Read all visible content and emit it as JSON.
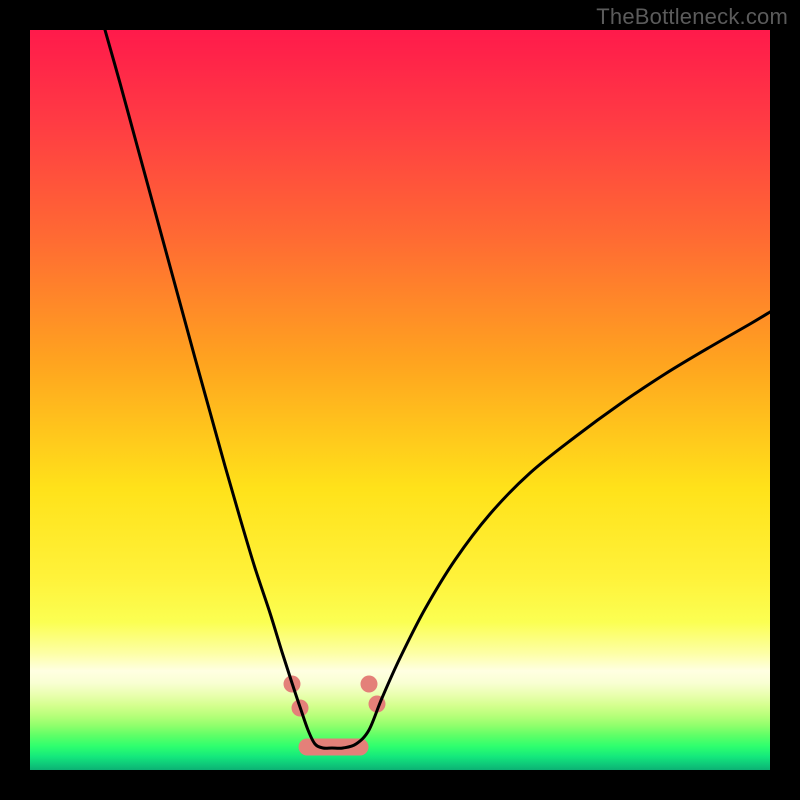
{
  "watermark": "TheBottleneck.com",
  "colors": {
    "frame": "#000000",
    "salmon": "#e48079",
    "curve": "#000000",
    "gradient_stops": [
      {
        "offset": 0.0,
        "color": "#ff1a4b"
      },
      {
        "offset": 0.12,
        "color": "#ff3a44"
      },
      {
        "offset": 0.28,
        "color": "#ff6a33"
      },
      {
        "offset": 0.45,
        "color": "#ffa41f"
      },
      {
        "offset": 0.62,
        "color": "#ffe21a"
      },
      {
        "offset": 0.74,
        "color": "#fff23a"
      },
      {
        "offset": 0.8,
        "color": "#fbff52"
      },
      {
        "offset": 0.842,
        "color": "#fdffa5"
      },
      {
        "offset": 0.866,
        "color": "#ffffe2"
      },
      {
        "offset": 0.882,
        "color": "#f9ffd3"
      },
      {
        "offset": 0.898,
        "color": "#eaffb0"
      },
      {
        "offset": 0.912,
        "color": "#d6ff90"
      },
      {
        "offset": 0.926,
        "color": "#b8ff7a"
      },
      {
        "offset": 0.94,
        "color": "#90ff6c"
      },
      {
        "offset": 0.954,
        "color": "#5cff67"
      },
      {
        "offset": 0.968,
        "color": "#2eff6e"
      },
      {
        "offset": 0.982,
        "color": "#14e87c"
      },
      {
        "offset": 0.992,
        "color": "#0fca7a"
      },
      {
        "offset": 1.0,
        "color": "#0cb173"
      }
    ]
  },
  "chart_data": {
    "type": "line",
    "title": "",
    "xlabel": "",
    "ylabel": "",
    "xlim": [
      0,
      1000
    ],
    "ylim": [
      0,
      1000
    ],
    "note": "Axes are implicit (no ticks or labels are drawn). Values are in plot-area pixel coordinates with (0,0) at top-left of the 740×740 gradient region. Curve is a deep V with minimum near x≈300, flat trough ~y=718, rising smoothly to the right edge at y≈275.",
    "series": [
      {
        "name": "left-branch",
        "x": [
          75,
          90,
          105,
          120,
          135,
          150,
          165,
          180,
          195,
          210,
          225,
          240,
          252,
          262,
          270,
          278
        ],
        "y": [
          0,
          53,
          108,
          163,
          218,
          273,
          328,
          382,
          436,
          488,
          538,
          583,
          622,
          653,
          677,
          700
        ]
      },
      {
        "name": "trough",
        "x": [
          278,
          285,
          293,
          302,
          313,
          326,
          339
        ],
        "y": [
          700,
          714,
          718,
          718,
          718,
          714,
          700
        ]
      },
      {
        "name": "right-branch",
        "x": [
          339,
          352,
          370,
          395,
          425,
          460,
          500,
          545,
          590,
          635,
          680,
          720,
          740
        ],
        "y": [
          700,
          668,
          628,
          579,
          530,
          484,
          443,
          407,
          374,
          344,
          317,
          294,
          282
        ]
      }
    ],
    "markers": {
      "name": "salmon-dots-and-trough",
      "color": "#e48079",
      "points": [
        {
          "x": 262,
          "y": 654,
          "r": 8.5
        },
        {
          "x": 270,
          "y": 678,
          "r": 8.5
        },
        {
          "x": 339,
          "y": 654,
          "r": 8.5
        },
        {
          "x": 347,
          "y": 674,
          "r": 8.5
        }
      ],
      "trough_band": {
        "x1": 277,
        "x2": 330,
        "y": 717,
        "thickness": 17
      }
    }
  }
}
